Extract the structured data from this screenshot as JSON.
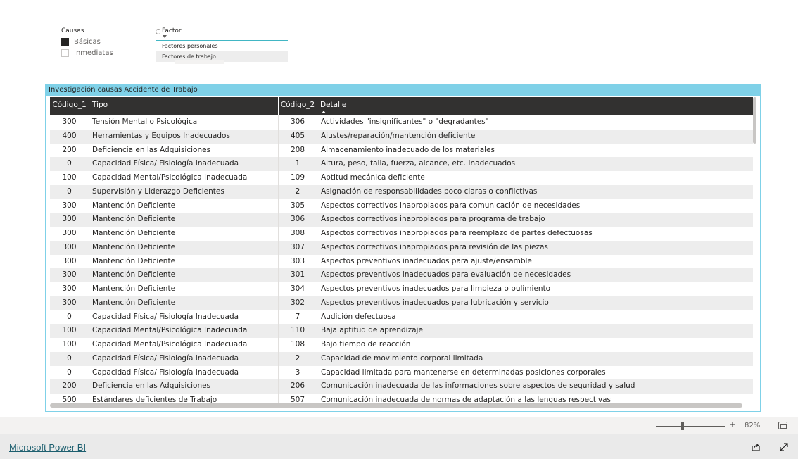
{
  "slicer_causas": {
    "title": "Causas",
    "options": [
      {
        "label": "Básicas",
        "checked": true
      },
      {
        "label": "Inmediatas",
        "checked": false
      }
    ]
  },
  "slicer_factor": {
    "title": "Factor",
    "options": [
      "Factores personales",
      "Factores de trabajo"
    ],
    "selected": "Factores de trabajo"
  },
  "table": {
    "title": "Investigación causas Accidente de Trabajo",
    "columns": [
      "Código_1",
      "Tipo",
      "Código_2",
      "Detalle"
    ],
    "sorted_column": "Detalle",
    "rows": [
      [
        "300",
        "Tensión Mental o Psicológica",
        "306",
        "Actividades \"insignificantes\" o \"degradantes\""
      ],
      [
        "400",
        "Herramientas y Equipos Inadecuados",
        "405",
        "Ajustes/reparación/mantención deficiente"
      ],
      [
        "200",
        "Deficiencia en las Adquisiciones",
        "208",
        "Almacenamiento inadecuado de los materiales"
      ],
      [
        "0",
        "Capacidad Física/ Fisiología Inadecuada",
        "1",
        "Altura, peso, talla, fuerza, alcance, etc. Inadecuados"
      ],
      [
        "100",
        "Capacidad Mental/Psicológica Inadecuada",
        "109",
        "Aptitud mecánica deficiente"
      ],
      [
        "0",
        "Supervisión y Liderazgo Deficientes",
        "2",
        "Asignación de responsabilidades poco claras o conflictivas"
      ],
      [
        "300",
        "Mantención Deficiente",
        "305",
        "Aspectos correctivos inapropiados para comunicación de necesidades"
      ],
      [
        "300",
        "Mantención Deficiente",
        "306",
        "Aspectos correctivos inapropiados para programa de trabajo"
      ],
      [
        "300",
        "Mantención Deficiente",
        "308",
        "Aspectos correctivos inapropiados para reemplazo de partes defectuosas"
      ],
      [
        "300",
        "Mantención Deficiente",
        "307",
        "Aspectos correctivos inapropiados para revisión de las piezas"
      ],
      [
        "300",
        "Mantención Deficiente",
        "303",
        "Aspectos preventivos inadecuados para ajuste/ensamble"
      ],
      [
        "300",
        "Mantención Deficiente",
        "301",
        "Aspectos preventivos inadecuados para evaluación de necesidades"
      ],
      [
        "300",
        "Mantención Deficiente",
        "304",
        "Aspectos preventivos inadecuados para limpieza o pulimiento"
      ],
      [
        "300",
        "Mantención Deficiente",
        "302",
        "Aspectos preventivos inadecuados para lubricación y servicio"
      ],
      [
        "0",
        "Capacidad Física/ Fisiología Inadecuada",
        "7",
        "Audición defectuosa"
      ],
      [
        "100",
        "Capacidad Mental/Psicológica Inadecuada",
        "110",
        "Baja aptitud de aprendizaje"
      ],
      [
        "100",
        "Capacidad Mental/Psicológica Inadecuada",
        "108",
        "Bajo tiempo de reacción"
      ],
      [
        "0",
        "Capacidad Física/ Fisiología Inadecuada",
        "2",
        "Capacidad de movimiento corporal limitada"
      ],
      [
        "0",
        "Capacidad Física/ Fisiología Inadecuada",
        "3",
        "Capacidad limitada para mantenerse en determinadas posiciones corporales"
      ],
      [
        "200",
        "Deficiencia en las Adquisiciones",
        "206",
        "Comunicación inadecuada de las informaciones sobre aspectos de seguridad y salud"
      ],
      [
        "500",
        "Estándares deficientes de Trabajo",
        "507",
        "Comunicación inadecuada de normas de adaptación a las lenguas respectivas"
      ]
    ]
  },
  "zoom": {
    "minus": "-",
    "plus": "+",
    "percent": "82%",
    "level": 0.82
  },
  "footer": {
    "brand": "Microsoft Power BI"
  },
  "colors": {
    "accent": "#7fd1e8",
    "header_bg": "#323130",
    "alt_row": "#ededed",
    "brand_link": "#1d5f6f"
  },
  "icons": {
    "share": "share-icon",
    "fullscreen": "fullscreen-icon",
    "fit": "fit-to-page-icon"
  }
}
